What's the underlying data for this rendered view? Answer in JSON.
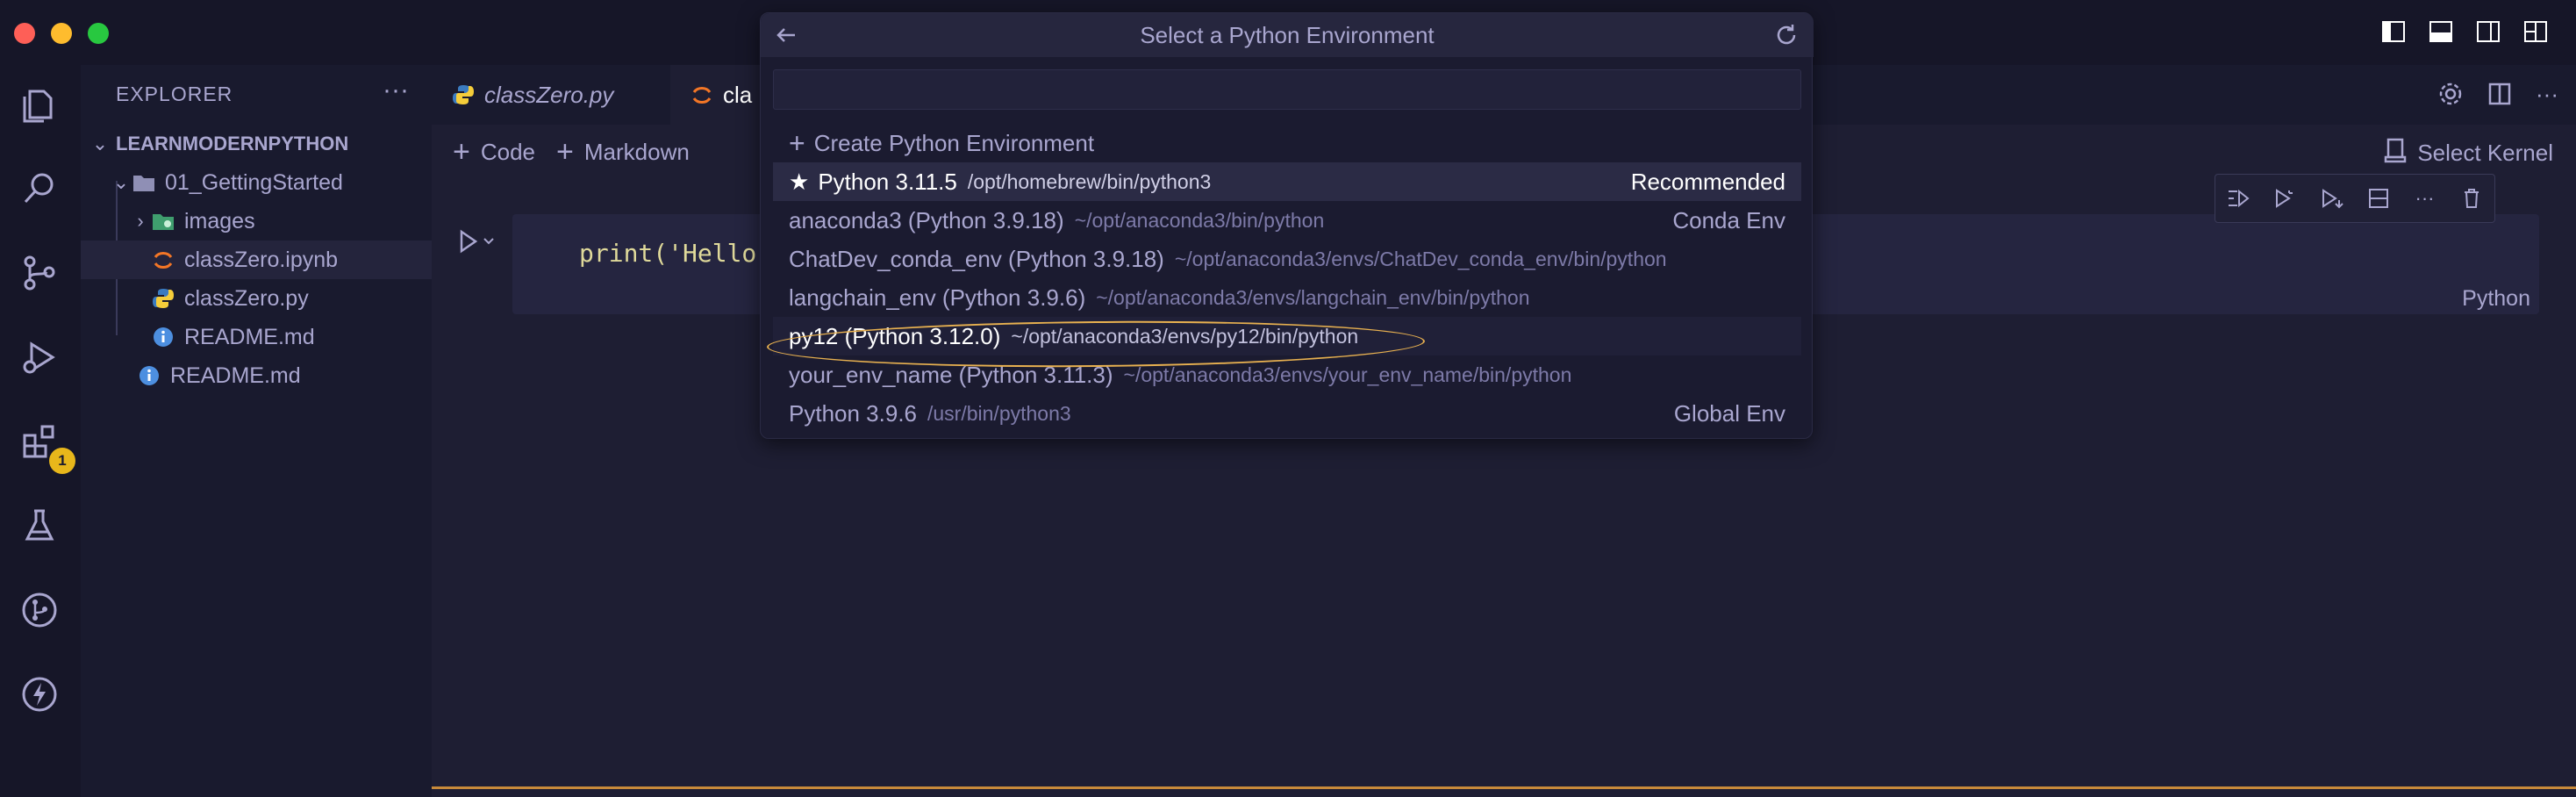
{
  "sidebar": {
    "title": "EXPLORER",
    "more": "···",
    "tree": [
      {
        "label": "LEARNMODERNPYTHON",
        "kind": "root"
      },
      {
        "label": "01_GettingStarted",
        "kind": "folder"
      },
      {
        "label": "images",
        "kind": "folder"
      },
      {
        "label": "classZero.ipynb",
        "kind": "notebook"
      },
      {
        "label": "classZero.py",
        "kind": "python"
      },
      {
        "label": "README.md",
        "kind": "info"
      },
      {
        "label": "README.md",
        "kind": "info"
      }
    ]
  },
  "activity": {
    "extensions_badge": "1"
  },
  "tabs": [
    {
      "label": "classZero.py"
    },
    {
      "label": "cla"
    }
  ],
  "toolbar": {
    "code_label": "Code",
    "markdown_label": "Markdown",
    "kernel_label": "Select Kernel"
  },
  "cell": {
    "code": "print('Hello",
    "language": "Python"
  },
  "picker": {
    "title": "Select a Python Environment",
    "input_value": "",
    "create_label": "Create Python Environment",
    "items": [
      {
        "name": "Python 3.11.5",
        "path": "/opt/homebrew/bin/python3",
        "tag": "Recommended",
        "star": "★"
      },
      {
        "name": "anaconda3 (Python 3.9.18)",
        "path": "~/opt/anaconda3/bin/python",
        "tag": "Conda Env"
      },
      {
        "name": "ChatDev_conda_env (Python 3.9.18)",
        "path": "~/opt/anaconda3/envs/ChatDev_conda_env/bin/python",
        "tag": ""
      },
      {
        "name": "langchain_env (Python 3.9.6)",
        "path": "~/opt/anaconda3/envs/langchain_env/bin/python",
        "tag": ""
      },
      {
        "name": "py12 (Python 3.12.0)",
        "path": "~/opt/anaconda3/envs/py12/bin/python",
        "tag": ""
      },
      {
        "name": "your_env_name (Python 3.11.3)",
        "path": "~/opt/anaconda3/envs/your_env_name/bin/python",
        "tag": ""
      },
      {
        "name": "Python 3.9.6",
        "path": "/usr/bin/python3",
        "tag": "Global Env"
      }
    ]
  },
  "colors": {
    "accent": "#e8b150",
    "badge": "#e8b71b",
    "background": "#1e1e33"
  }
}
